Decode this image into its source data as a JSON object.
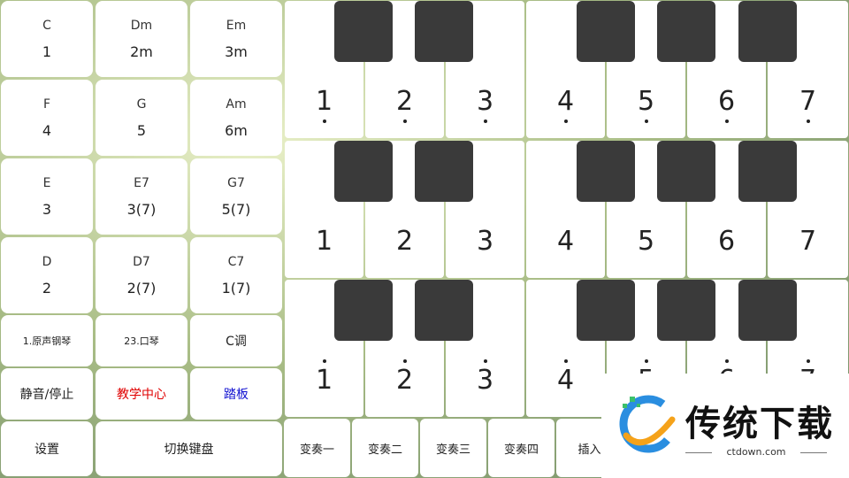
{
  "chords": [
    {
      "name": "C",
      "num": "1"
    },
    {
      "name": "Dm",
      "num": "2m"
    },
    {
      "name": "Em",
      "num": "3m"
    },
    {
      "name": "F",
      "num": "4"
    },
    {
      "name": "G",
      "num": "5"
    },
    {
      "name": "Am",
      "num": "6m"
    },
    {
      "name": "E",
      "num": "3"
    },
    {
      "name": "E7",
      "num": "3(7)"
    },
    {
      "name": "G7",
      "num": "5(7)"
    },
    {
      "name": "D",
      "num": "2"
    },
    {
      "name": "D7",
      "num": "2(7)"
    },
    {
      "name": "C7",
      "num": "1(7)"
    }
  ],
  "controls": {
    "instrument": "1.原声钢琴",
    "instrument2": "23.口琴",
    "key": "C调",
    "mute": "静音/停止",
    "teaching": "教学中心",
    "pedal": "踏板",
    "settings": "设置",
    "switch_keyboard": "切换键盘"
  },
  "colors": {
    "teaching": "#e00000",
    "pedal": "#1010d0",
    "black_key": "#3a3a3a"
  },
  "keyboard_rows": [
    {
      "octave": "high",
      "keys": [
        "1",
        "2",
        "3",
        "4",
        "5",
        "6",
        "7"
      ]
    },
    {
      "octave": "middle",
      "keys": [
        "1",
        "2",
        "3",
        "4",
        "5",
        "6",
        "7"
      ]
    },
    {
      "octave": "low",
      "keys": [
        "1",
        "2",
        "3",
        "4",
        "5",
        "6",
        "7"
      ]
    }
  ],
  "variations": [
    "变奏一",
    "变奏二",
    "变奏三",
    "变奏四",
    "插入"
  ],
  "watermark": {
    "title": "传统下载",
    "url": "ctdown.com"
  }
}
